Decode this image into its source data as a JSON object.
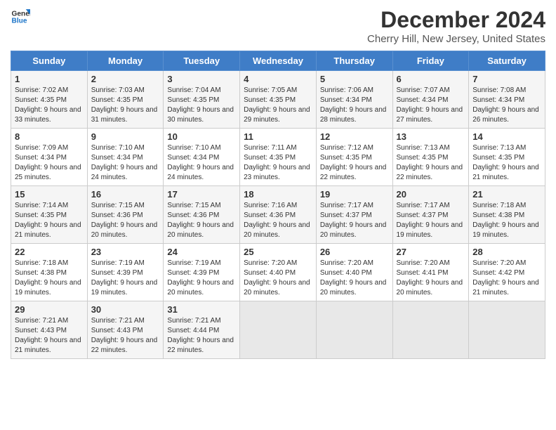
{
  "logo": {
    "line1": "General",
    "line2": "Blue"
  },
  "title": "December 2024",
  "subtitle": "Cherry Hill, New Jersey, United States",
  "days_of_week": [
    "Sunday",
    "Monday",
    "Tuesday",
    "Wednesday",
    "Thursday",
    "Friday",
    "Saturday"
  ],
  "weeks": [
    [
      {
        "day": "1",
        "sunrise": "7:02 AM",
        "sunset": "4:35 PM",
        "daylight": "9 hours and 33 minutes."
      },
      {
        "day": "2",
        "sunrise": "7:03 AM",
        "sunset": "4:35 PM",
        "daylight": "9 hours and 31 minutes."
      },
      {
        "day": "3",
        "sunrise": "7:04 AM",
        "sunset": "4:35 PM",
        "daylight": "9 hours and 30 minutes."
      },
      {
        "day": "4",
        "sunrise": "7:05 AM",
        "sunset": "4:35 PM",
        "daylight": "9 hours and 29 minutes."
      },
      {
        "day": "5",
        "sunrise": "7:06 AM",
        "sunset": "4:34 PM",
        "daylight": "9 hours and 28 minutes."
      },
      {
        "day": "6",
        "sunrise": "7:07 AM",
        "sunset": "4:34 PM",
        "daylight": "9 hours and 27 minutes."
      },
      {
        "day": "7",
        "sunrise": "7:08 AM",
        "sunset": "4:34 PM",
        "daylight": "9 hours and 26 minutes."
      }
    ],
    [
      {
        "day": "8",
        "sunrise": "7:09 AM",
        "sunset": "4:34 PM",
        "daylight": "9 hours and 25 minutes."
      },
      {
        "day": "9",
        "sunrise": "7:10 AM",
        "sunset": "4:34 PM",
        "daylight": "9 hours and 24 minutes."
      },
      {
        "day": "10",
        "sunrise": "7:10 AM",
        "sunset": "4:34 PM",
        "daylight": "9 hours and 24 minutes."
      },
      {
        "day": "11",
        "sunrise": "7:11 AM",
        "sunset": "4:35 PM",
        "daylight": "9 hours and 23 minutes."
      },
      {
        "day": "12",
        "sunrise": "7:12 AM",
        "sunset": "4:35 PM",
        "daylight": "9 hours and 22 minutes."
      },
      {
        "day": "13",
        "sunrise": "7:13 AM",
        "sunset": "4:35 PM",
        "daylight": "9 hours and 22 minutes."
      },
      {
        "day": "14",
        "sunrise": "7:13 AM",
        "sunset": "4:35 PM",
        "daylight": "9 hours and 21 minutes."
      }
    ],
    [
      {
        "day": "15",
        "sunrise": "7:14 AM",
        "sunset": "4:35 PM",
        "daylight": "9 hours and 21 minutes."
      },
      {
        "day": "16",
        "sunrise": "7:15 AM",
        "sunset": "4:36 PM",
        "daylight": "9 hours and 20 minutes."
      },
      {
        "day": "17",
        "sunrise": "7:15 AM",
        "sunset": "4:36 PM",
        "daylight": "9 hours and 20 minutes."
      },
      {
        "day": "18",
        "sunrise": "7:16 AM",
        "sunset": "4:36 PM",
        "daylight": "9 hours and 20 minutes."
      },
      {
        "day": "19",
        "sunrise": "7:17 AM",
        "sunset": "4:37 PM",
        "daylight": "9 hours and 20 minutes."
      },
      {
        "day": "20",
        "sunrise": "7:17 AM",
        "sunset": "4:37 PM",
        "daylight": "9 hours and 19 minutes."
      },
      {
        "day": "21",
        "sunrise": "7:18 AM",
        "sunset": "4:38 PM",
        "daylight": "9 hours and 19 minutes."
      }
    ],
    [
      {
        "day": "22",
        "sunrise": "7:18 AM",
        "sunset": "4:38 PM",
        "daylight": "9 hours and 19 minutes."
      },
      {
        "day": "23",
        "sunrise": "7:19 AM",
        "sunset": "4:39 PM",
        "daylight": "9 hours and 19 minutes."
      },
      {
        "day": "24",
        "sunrise": "7:19 AM",
        "sunset": "4:39 PM",
        "daylight": "9 hours and 20 minutes."
      },
      {
        "day": "25",
        "sunrise": "7:20 AM",
        "sunset": "4:40 PM",
        "daylight": "9 hours and 20 minutes."
      },
      {
        "day": "26",
        "sunrise": "7:20 AM",
        "sunset": "4:40 PM",
        "daylight": "9 hours and 20 minutes."
      },
      {
        "day": "27",
        "sunrise": "7:20 AM",
        "sunset": "4:41 PM",
        "daylight": "9 hours and 20 minutes."
      },
      {
        "day": "28",
        "sunrise": "7:20 AM",
        "sunset": "4:42 PM",
        "daylight": "9 hours and 21 minutes."
      }
    ],
    [
      {
        "day": "29",
        "sunrise": "7:21 AM",
        "sunset": "4:43 PM",
        "daylight": "9 hours and 21 minutes."
      },
      {
        "day": "30",
        "sunrise": "7:21 AM",
        "sunset": "4:43 PM",
        "daylight": "9 hours and 22 minutes."
      },
      {
        "day": "31",
        "sunrise": "7:21 AM",
        "sunset": "4:44 PM",
        "daylight": "9 hours and 22 minutes."
      },
      null,
      null,
      null,
      null
    ]
  ]
}
